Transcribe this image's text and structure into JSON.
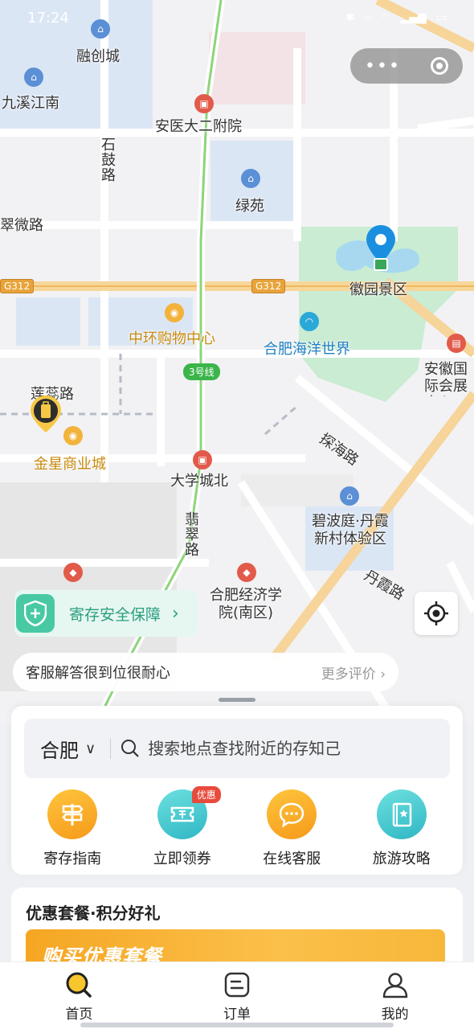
{
  "status_bar": {
    "time": "17:24",
    "icons": [
      "location-icon",
      "bluetooth-icon",
      "wifi-icon",
      "signal-icon",
      "battery-icon"
    ]
  },
  "map": {
    "labels": {
      "rongchuang": "融创城",
      "jiuxi": "九溪江南",
      "anyi_hospital": "安医大二附院",
      "shigu_road": "石鼓路",
      "lvyuan": "绿苑",
      "cuiwei_road": "翠微路",
      "g312_left": "G312",
      "g312_mid": "G312",
      "huiyuan": "徽园景区",
      "zhonghuan_mall": "中环购物中心",
      "ocean_world": "合肥海洋世界",
      "line3": "3号线",
      "anhui_expo": "安徽国际会展中心",
      "lianrui_road": "莲蕊路",
      "jinxing": "金星商业城",
      "tanhai_road": "探海路",
      "daxuecheng_north": "大学城北",
      "bibo": "碧波庭·丹霞新村体验区",
      "feicui_road": "翡翠路",
      "danxia_road": "丹霞路",
      "hefei_econ": "合肥经济学院(南区)"
    }
  },
  "top_capsule": {
    "more_icon": "more-dots-icon",
    "close_icon": "target-icon"
  },
  "safety_banner": {
    "label": "寄存安全保障",
    "icon": "shield-plus-icon"
  },
  "review_bar": {
    "message": "客服解答很到位很耐心",
    "more": "更多评价"
  },
  "search": {
    "city": "合肥",
    "placeholder": "搜索地点查找附近的存知己"
  },
  "quick_actions": [
    {
      "label": "寄存指南",
      "icon": "signpost-icon",
      "color": "#f7a823"
    },
    {
      "label": "立即领券",
      "icon": "ticket-icon",
      "color": "#3cc3cc",
      "badge": "优惠"
    },
    {
      "label": "在线客服",
      "icon": "chat-icon",
      "color": "#f7a823"
    },
    {
      "label": "旅游攻略",
      "icon": "guidebook-icon",
      "color": "#3cc3cc"
    }
  ],
  "promo": {
    "title": "优惠套餐·积分好礼",
    "banner_text": "购买优惠套餐"
  },
  "tabs": [
    {
      "label": "首页",
      "icon": "home-search-icon",
      "active": true
    },
    {
      "label": "订单",
      "icon": "order-icon"
    },
    {
      "label": "我的",
      "icon": "profile-icon"
    }
  ],
  "colors": {
    "accent": "#f7b52c",
    "teal": "#3cc3cc",
    "safety_green": "#48c9a4",
    "pin_blue": "#1a8fe0"
  }
}
